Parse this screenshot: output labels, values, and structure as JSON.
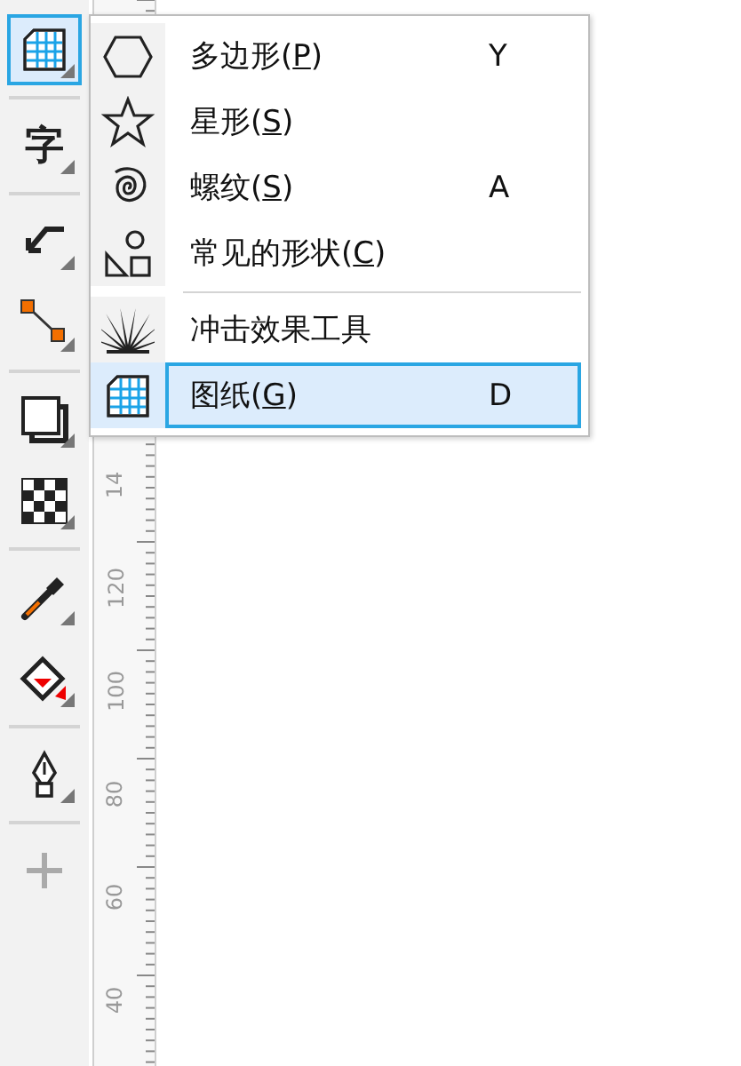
{
  "toolbar": {
    "groups": [
      [
        {
          "selected": true
        }
      ],
      [
        {
          "selected": false,
          "glyph": "字"
        }
      ],
      [
        {
          "selected": false
        },
        {
          "selected": false
        }
      ],
      [
        {
          "selected": false
        },
        {
          "selected": false
        }
      ],
      [
        {
          "selected": false
        },
        {
          "selected": false
        }
      ],
      [
        {
          "selected": false
        }
      ],
      [
        {
          "selected": false
        }
      ]
    ]
  },
  "ruler": {
    "labels": [
      "14",
      "120",
      "100",
      "80",
      "60",
      "40"
    ]
  },
  "menu": {
    "sections": [
      [
        {
          "label_parts": [
            "多边形(",
            "P",
            ")"
          ],
          "shortcut": "Y",
          "selected": false
        },
        {
          "label_parts": [
            "星形(",
            "S",
            ")"
          ],
          "selected": false
        },
        {
          "label_parts": [
            "螺纹(",
            "S",
            ")"
          ],
          "shortcut": "A",
          "selected": false
        },
        {
          "label_parts": [
            "常见的形状(",
            "C",
            ")"
          ],
          "selected": false
        }
      ],
      [
        {
          "label_parts": [
            "冲击效果工具"
          ],
          "selected": false
        },
        {
          "label_parts": [
            "图纸(",
            "G",
            ")"
          ],
          "shortcut": "D",
          "selected": true
        }
      ]
    ]
  }
}
